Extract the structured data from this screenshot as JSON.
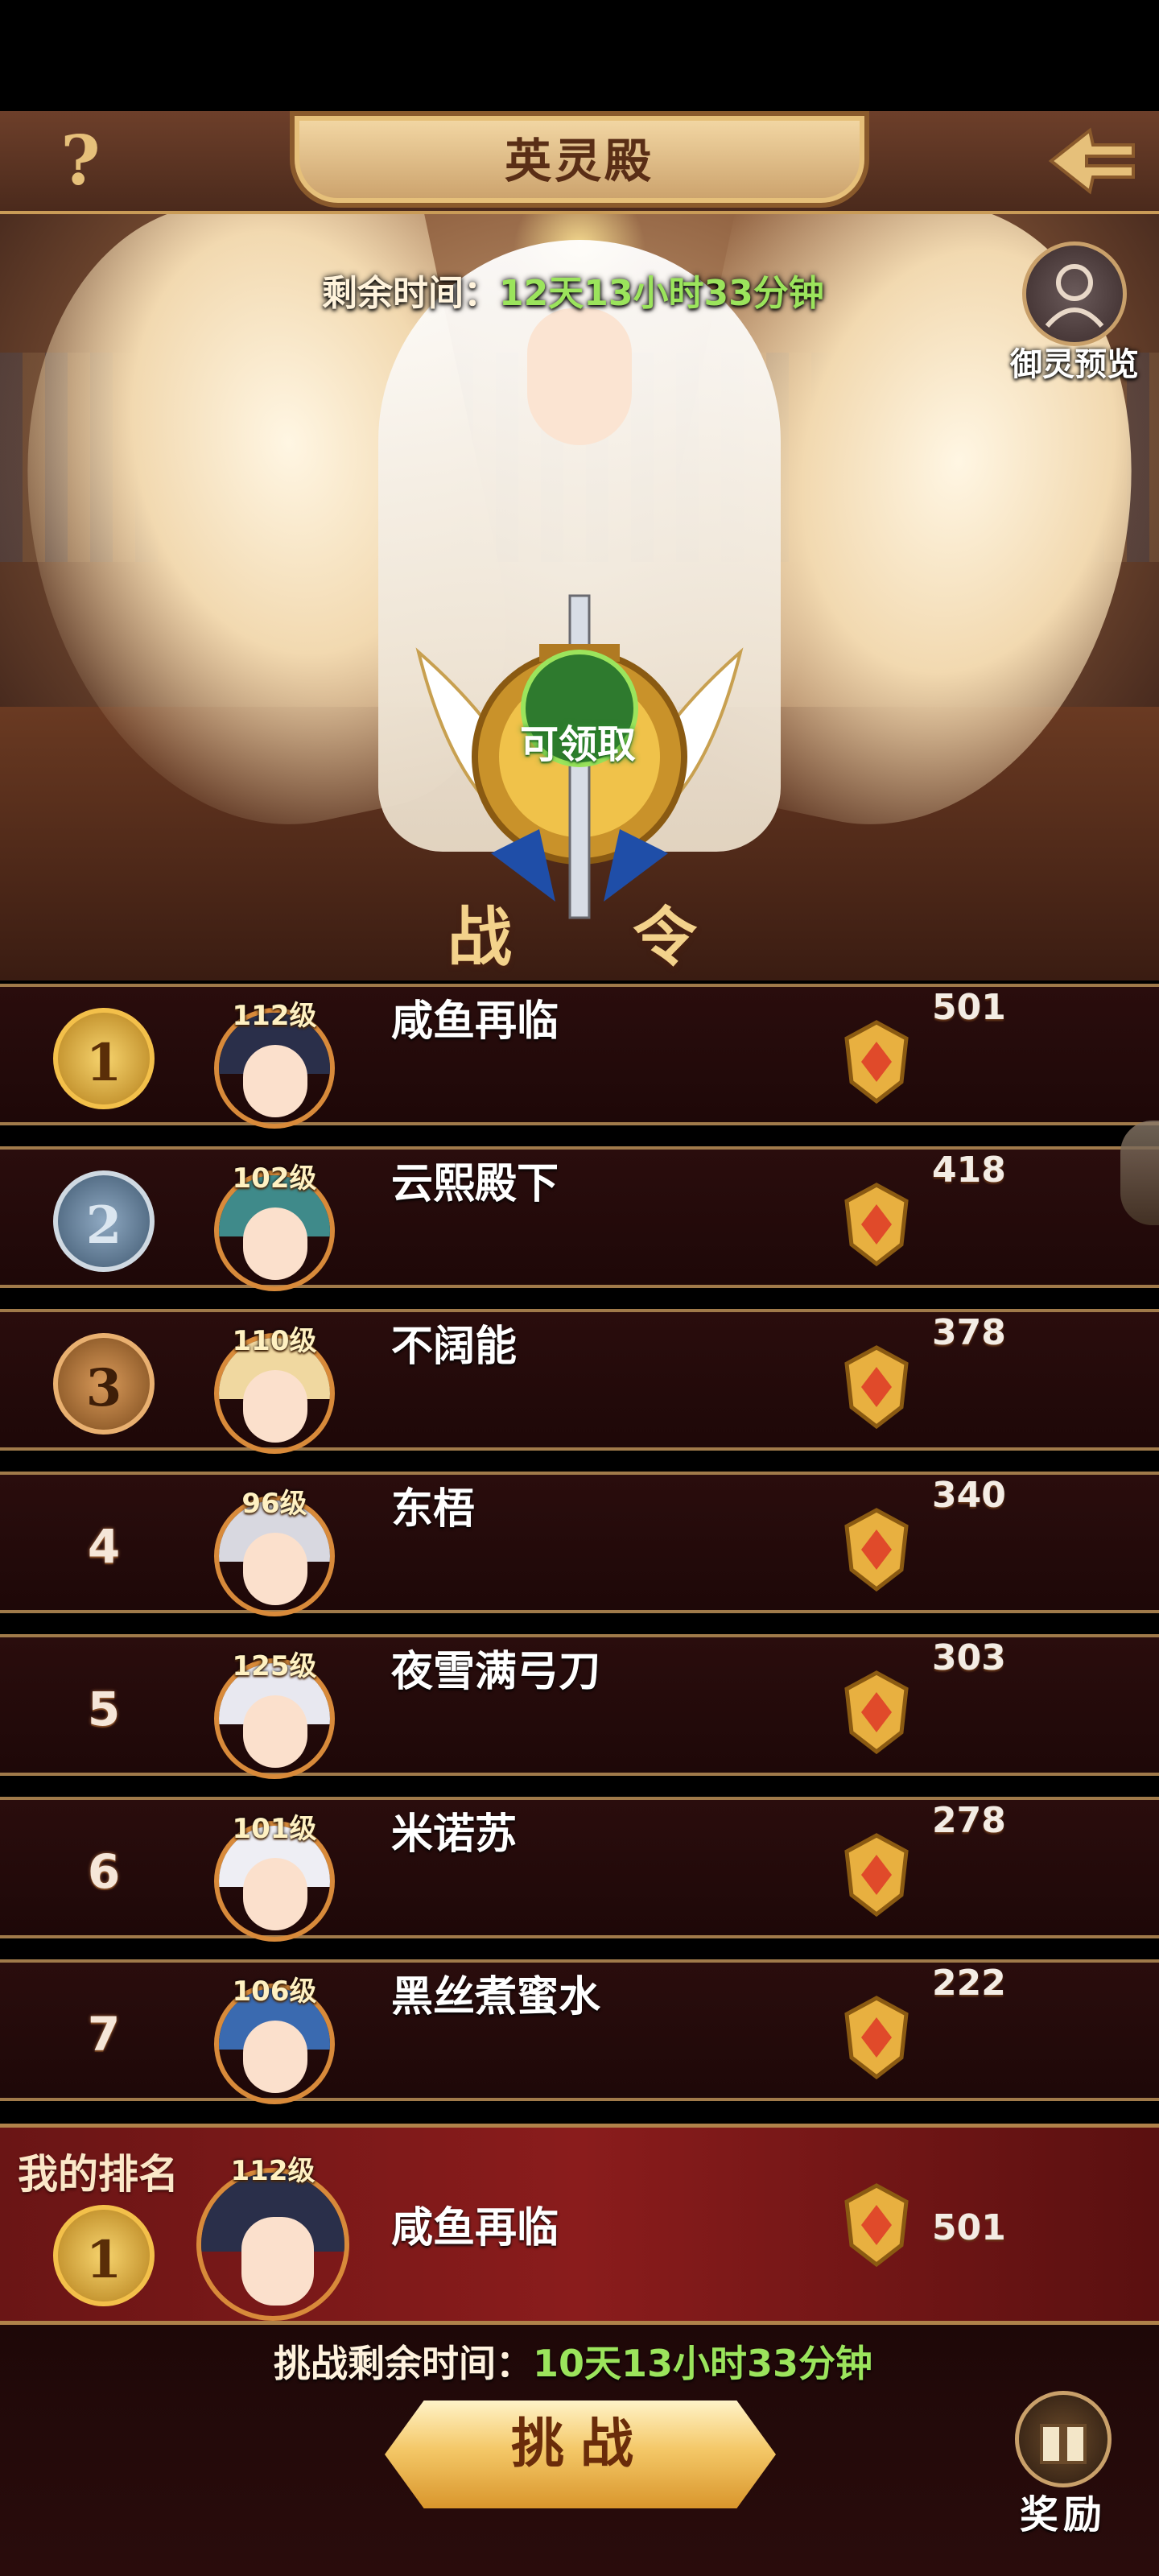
{
  "header": {
    "title": "英灵殿",
    "help_label": "?"
  },
  "event": {
    "remaining_label": "剩余时间：",
    "remaining_value": "12天13小时33分钟",
    "preview_label": "御灵预览"
  },
  "battle_pass": {
    "claim_label": "可领取",
    "title_left": "战",
    "title_right": "令"
  },
  "rankings": [
    {
      "rank": "1",
      "level": "112级",
      "name": "咸鱼再临",
      "score": "501",
      "medal": "gold",
      "hair": "#2a2f4a"
    },
    {
      "rank": "2",
      "level": "102级",
      "name": "云熙殿下",
      "score": "418",
      "medal": "silver",
      "hair": "#3f8a8a"
    },
    {
      "rank": "3",
      "level": "110级",
      "name": "不阔能",
      "score": "378",
      "medal": "bronze",
      "hair": "#f0d8a0"
    },
    {
      "rank": "4",
      "level": "96级",
      "name": "东梧",
      "score": "340",
      "medal": "plain",
      "hair": "#d8d8e0"
    },
    {
      "rank": "5",
      "level": "125级",
      "name": "夜雪满弓刀",
      "score": "303",
      "medal": "plain",
      "hair": "#e8e8f0"
    },
    {
      "rank": "6",
      "level": "101级",
      "name": "米诺苏",
      "score": "278",
      "medal": "plain",
      "hair": "#eeeef4"
    },
    {
      "rank": "7",
      "level": "106级",
      "name": "黑丝煮蜜水",
      "score": "222",
      "medal": "plain",
      "hair": "#3a6ab0"
    }
  ],
  "my_rank": {
    "label": "我的排名",
    "rank": "1",
    "level": "112级",
    "name": "咸鱼再临",
    "score": "501",
    "hair": "#2a2f4a"
  },
  "footer": {
    "challenge_time_label": "挑战剩余时间：",
    "challenge_time_value": "10天13小时33分钟",
    "challenge_button": "挑战",
    "reward_label": "奖励"
  }
}
